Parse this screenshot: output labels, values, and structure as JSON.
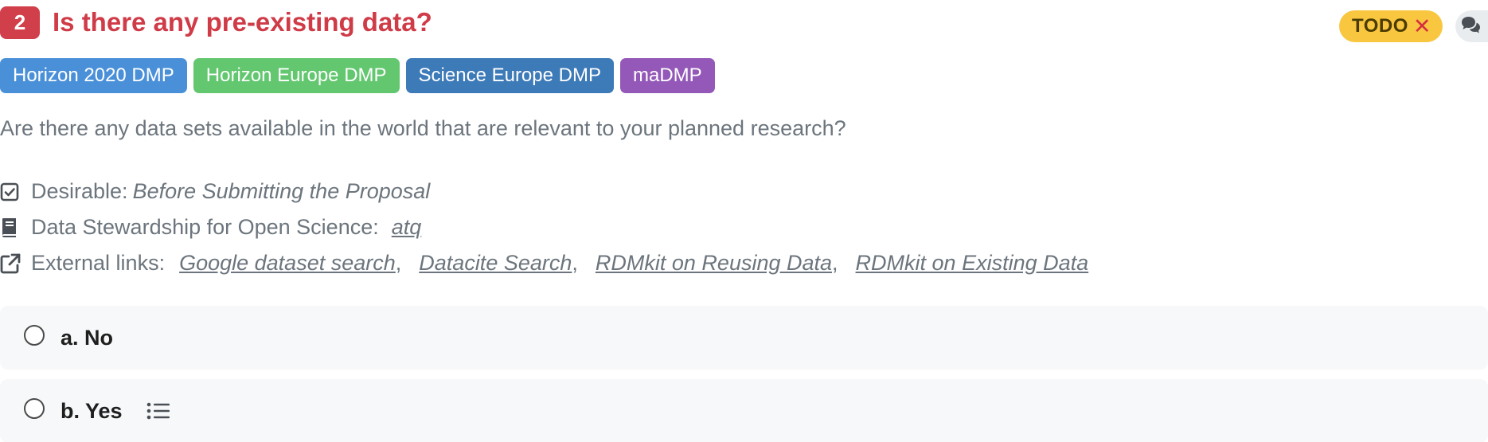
{
  "question": {
    "number": "2",
    "title": "Is there any pre-existing data?",
    "description": "Are there any data sets available in the world that are relevant to your planned research?"
  },
  "status": {
    "label": "TODO",
    "close_glyph": "✕",
    "color": "#f9c640"
  },
  "comments": {
    "icon": "comments-icon"
  },
  "tags": [
    {
      "label": "Horizon 2020 DMP",
      "color": "#4a90d9"
    },
    {
      "label": "Horizon Europe DMP",
      "color": "#62c76f"
    },
    {
      "label": "Science Europe DMP",
      "color": "#3d7ab8"
    },
    {
      "label": "maDMP",
      "color": "#9358b8"
    }
  ],
  "meta": {
    "desirable": {
      "icon": "checkbox-icon",
      "label": "Desirable:",
      "value": "Before Submitting the Proposal"
    },
    "book": {
      "icon": "book-icon",
      "label": "Data Stewardship for Open Science:",
      "value": "atq"
    },
    "external": {
      "icon": "external-link-icon",
      "label": "External links:",
      "links": [
        "Google dataset search",
        "Datacite Search",
        "RDMkit on Reusing Data",
        "RDMkit on Existing Data"
      ]
    }
  },
  "options": [
    {
      "label": "a. No"
    },
    {
      "label": "b. Yes",
      "followup_icon": "list-icon"
    }
  ]
}
